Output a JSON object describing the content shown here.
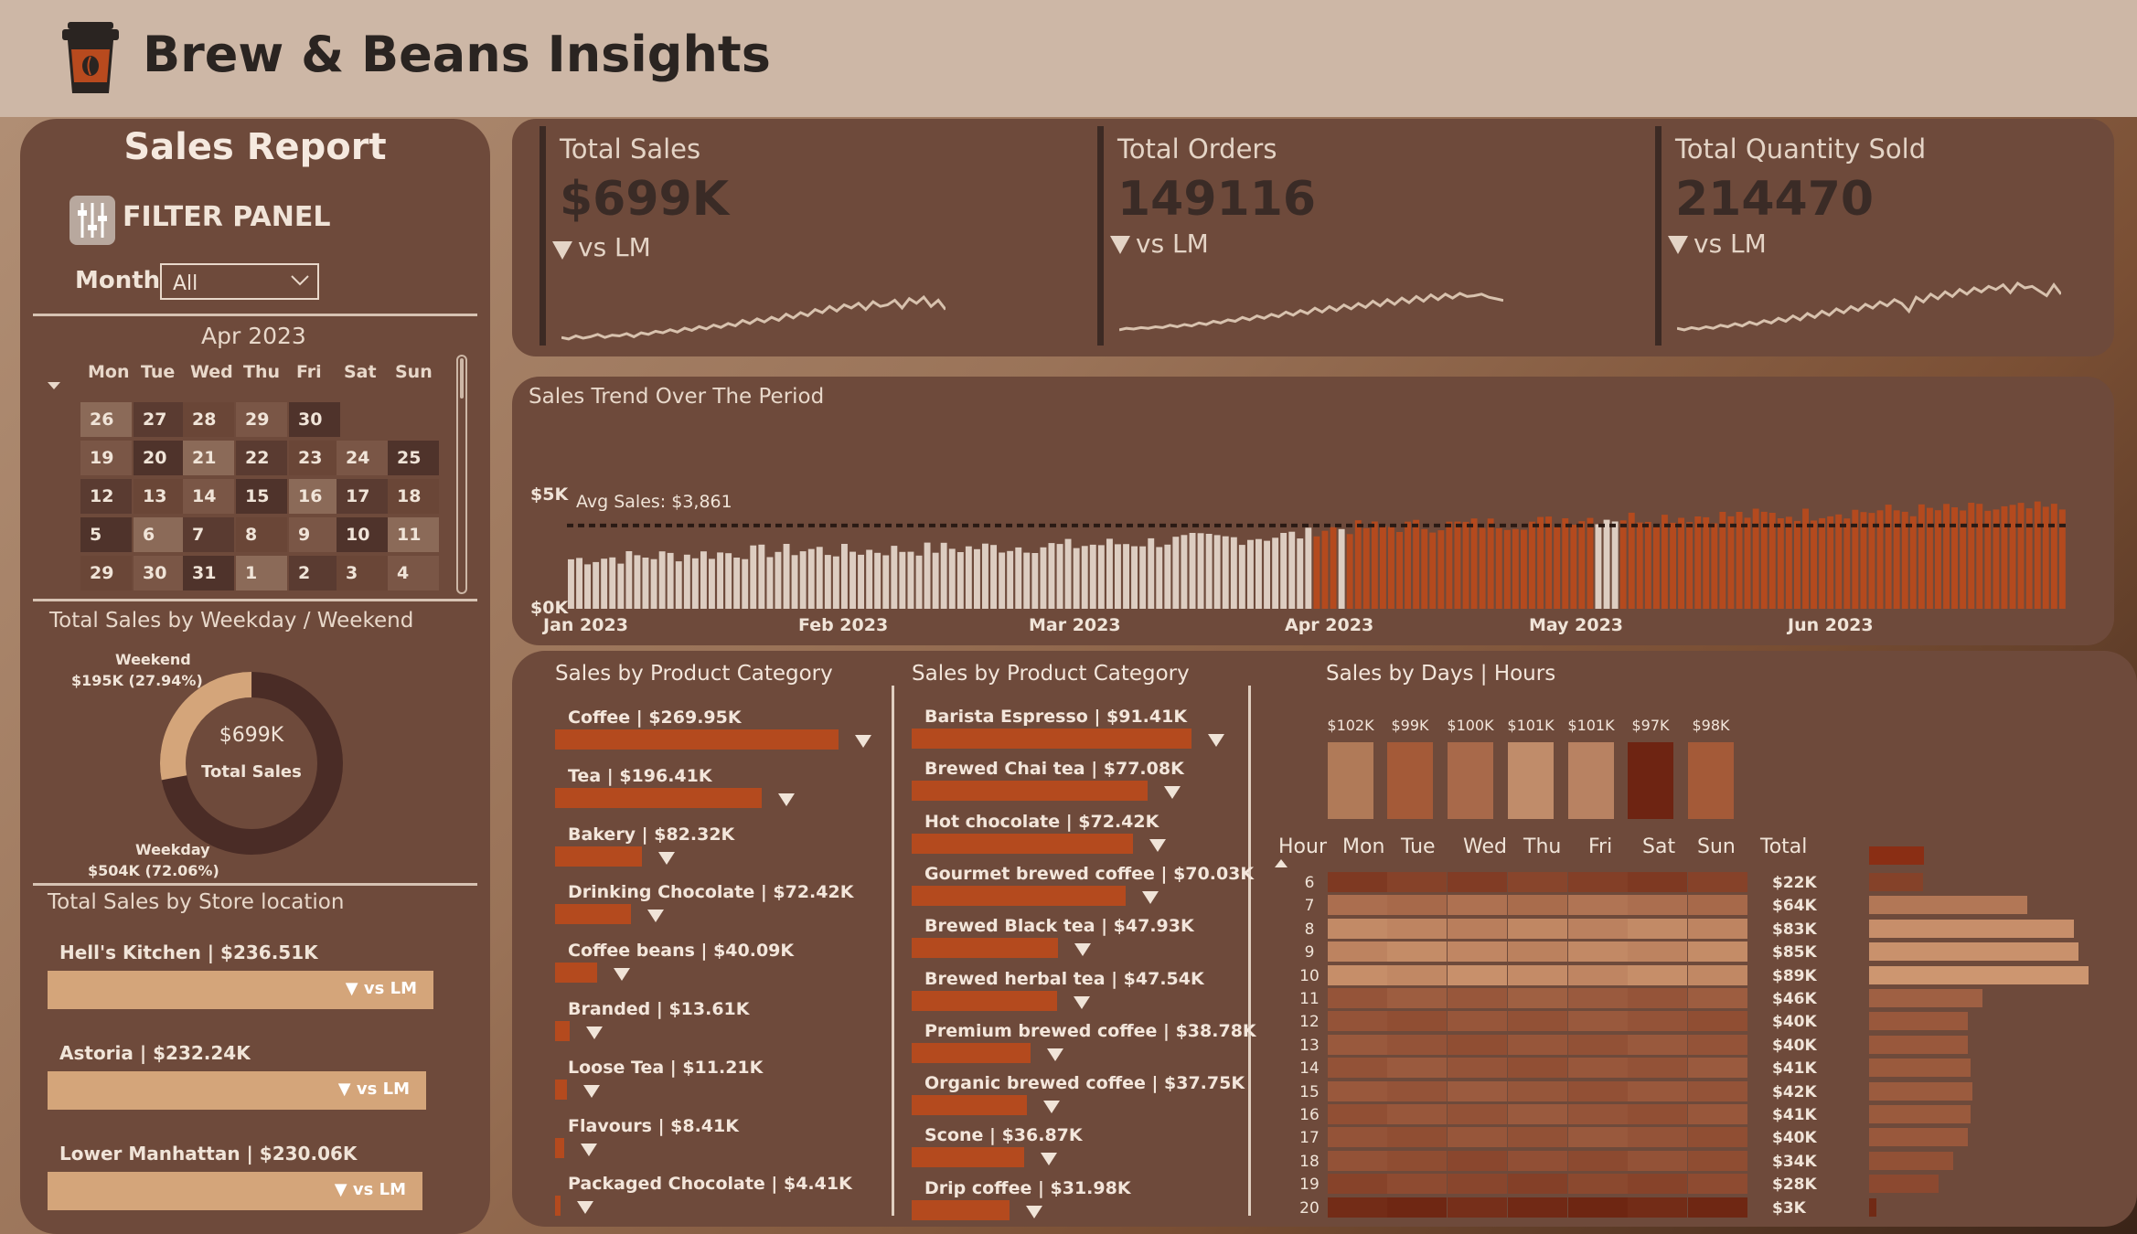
{
  "header": {
    "title": "Brew & Beans Insights",
    "logo_icon": "coffee-cup-icon"
  },
  "left_panel": {
    "title": "Sales Report",
    "filter_label": "FILTER PANEL",
    "month_label": "Month",
    "month_value": "All",
    "calendar": {
      "title": "Apr 2023",
      "weekdays": [
        "Mon",
        "Tue",
        "Wed",
        "Thu",
        "Fri",
        "Sat",
        "Sun"
      ],
      "rows": [
        [
          "26",
          "27",
          "28",
          "29",
          "30",
          "",
          ""
        ],
        [
          "19",
          "20",
          "21",
          "22",
          "23",
          "24",
          "25"
        ],
        [
          "12",
          "13",
          "14",
          "15",
          "16",
          "17",
          "18"
        ],
        [
          "5",
          "6",
          "7",
          "8",
          "9",
          "10",
          "11"
        ],
        [
          "29",
          "30",
          "31",
          "1",
          "2",
          "3",
          "4"
        ]
      ]
    },
    "weekday_weekend": {
      "title": "Total Sales by Weekday / Weekend",
      "center_value": "$699K",
      "center_label": "Total Sales",
      "weekend_label": "Weekend",
      "weekend_value": "$195K (27.94%)",
      "weekend_pct": 27.94,
      "weekday_label": "Weekday",
      "weekday_value": "$504K (72.06%)",
      "weekday_pct": 72.06
    },
    "store": {
      "title": "Total Sales by Store location",
      "vs_label": "vs LM",
      "items": [
        {
          "label": "Hell's Kitchen | $236.51K",
          "value": 236.51
        },
        {
          "label": "Astoria | $232.24K",
          "value": 232.24
        },
        {
          "label": "Lower Manhattan | $230.06K",
          "value": 230.06
        }
      ]
    }
  },
  "kpis": [
    {
      "label": "Total Sales",
      "value": "$699K",
      "vs": "vs LM"
    },
    {
      "label": "Total Orders",
      "value": "149116",
      "vs": "vs LM"
    },
    {
      "label": "Total Quantity Sold",
      "value": "214470",
      "vs": "vs LM"
    }
  ],
  "trend": {
    "title": "Sales Trend Over The Period",
    "avg_label": "Avg Sales: $3,861",
    "y_top": "$5K",
    "y_bottom": "$0K",
    "x_labels": [
      "Jan 2023",
      "Feb 2023",
      "Mar 2023",
      "Apr 2023",
      "May 2023",
      "Jun 2023"
    ]
  },
  "category1": {
    "title": "Sales by Product Category",
    "items": [
      {
        "label": "Coffee | $269.95K",
        "value": 269.95
      },
      {
        "label": "Tea | $196.41K",
        "value": 196.41
      },
      {
        "label": "Bakery | $82.32K",
        "value": 82.32
      },
      {
        "label": "Drinking Chocolate | $72.42K",
        "value": 72.42
      },
      {
        "label": "Coffee beans | $40.09K",
        "value": 40.09
      },
      {
        "label": "Branded | $13.61K",
        "value": 13.61
      },
      {
        "label": "Loose Tea | $11.21K",
        "value": 11.21
      },
      {
        "label": "Flavours | $8.41K",
        "value": 8.41
      },
      {
        "label": "Packaged Chocolate | $4.41K",
        "value": 4.41
      }
    ]
  },
  "category2": {
    "title": "Sales by Product Category",
    "items": [
      {
        "label": "Barista Espresso | $91.41K",
        "value": 91.41
      },
      {
        "label": "Brewed Chai tea | $77.08K",
        "value": 77.08
      },
      {
        "label": "Hot chocolate | $72.42K",
        "value": 72.42
      },
      {
        "label": "Gourmet brewed coffee | $70.03K",
        "value": 70.03
      },
      {
        "label": "Brewed Black tea | $47.93K",
        "value": 47.93
      },
      {
        "label": "Brewed herbal tea | $47.54K",
        "value": 47.54
      },
      {
        "label": "Premium brewed coffee | $38.78K",
        "value": 38.78
      },
      {
        "label": "Organic brewed coffee | $37.75K",
        "value": 37.75
      },
      {
        "label": "Scone | $36.87K",
        "value": 36.87
      },
      {
        "label": "Drip coffee | $31.98K",
        "value": 31.98
      }
    ]
  },
  "days_hours": {
    "title": "Sales by Days | Hours",
    "day_values": [
      "$102K",
      "$99K",
      "$100K",
      "$101K",
      "$101K",
      "$97K",
      "$98K"
    ],
    "day_colors": [
      "#b07a58",
      "#a45a38",
      "#a8694a",
      "#c08c6a",
      "#b88262",
      "#6e2412",
      "#a45a38"
    ],
    "headers": [
      "Hour",
      "Mon",
      "Tue",
      "Wed",
      "Thu",
      "Fri",
      "Sat",
      "Sun",
      "Total"
    ],
    "hours": [
      "6",
      "7",
      "8",
      "9",
      "10",
      "11",
      "12",
      "13",
      "14",
      "15",
      "16",
      "17",
      "18",
      "19",
      "20"
    ],
    "totals": [
      "$22K",
      "$64K",
      "$83K",
      "$85K",
      "$89K",
      "$46K",
      "$40K",
      "$40K",
      "$41K",
      "$42K",
      "$41K",
      "$40K",
      "$34K",
      "$28K",
      "$3K"
    ],
    "total_values": [
      22,
      64,
      83,
      85,
      89,
      46,
      40,
      40,
      41,
      42,
      41,
      40,
      34,
      28,
      3
    ]
  }
}
